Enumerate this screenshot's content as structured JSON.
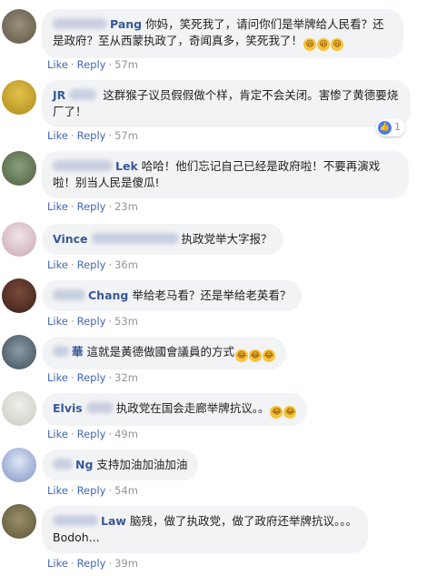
{
  "actions": {
    "like": "Like",
    "reply": "Reply",
    "separator": "·"
  },
  "comments": [
    {
      "author_visible": "Pang",
      "text": "你妈，笑死我了，请问你们是举牌给人民看？还是政府？至从西蒙执政了，奇闻真多，笑死我了！",
      "emoji_count": 3,
      "time": "57m"
    },
    {
      "author_visible": "JR",
      "text": "这群猴子议员假假做个样，肯定不会关闭。害惨了黄德要烧厂了！",
      "time": "57m",
      "reaction_count": "1"
    },
    {
      "author_visible": "Lek",
      "text": "哈哈！他们忘记自己已经是政府啦！不要再演戏啦！别当人民是傻瓜!",
      "time": "23m"
    },
    {
      "author_visible": "Vince",
      "text": "执政党举大字报？",
      "time": "36m"
    },
    {
      "author_visible": "Chang",
      "text": "举给老马看？还是举给老英看？",
      "time": "53m"
    },
    {
      "author_visible": "華",
      "text": "這就是黃德做國會議員的方式",
      "emoji_count": 3,
      "time": "32m"
    },
    {
      "author_visible": "Elvis",
      "text": "执政党在国会走廊举牌抗议。。",
      "emoji_count": 2,
      "time": "49m"
    },
    {
      "author_visible": "Ng",
      "text": "支持加油加油加油",
      "time": "54m"
    },
    {
      "author_visible": "Law",
      "text": "脑残，做了执政党，做了政府还举牌抗议。。。",
      "text2": "Bodoh...",
      "time": "39m"
    }
  ]
}
